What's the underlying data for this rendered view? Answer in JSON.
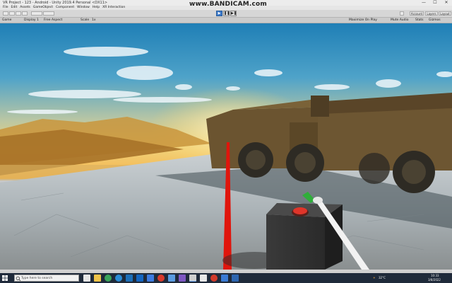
{
  "window": {
    "title": "VR Project - 123 - Android - Unity 2019.4 Personal <DX11>",
    "watermark": "www.BANDICAM.com",
    "controls": [
      "—",
      "☐",
      "✕"
    ]
  },
  "menu": [
    "File",
    "Edit",
    "Assets",
    "GameObject",
    "Component",
    "Window",
    "Help",
    "XR Interaction"
  ],
  "toolbar": {
    "account_label": "Account",
    "layers_label": "Layers",
    "layout_label": "Layout",
    "play_icons": [
      "▶",
      "❚❚",
      "▶❚"
    ]
  },
  "game_header": {
    "tab_label": "Game",
    "display_label": "Display 1",
    "aspect_label": "Free Aspect",
    "scale_label": "Scale",
    "scale_value": "1x",
    "maximize_label": "Maximize On Play",
    "mute_label": "Mute Audio",
    "stats_label": "Stats",
    "gizmos_label": "Gizmos"
  },
  "status": {
    "text": ""
  },
  "taskbar": {
    "search_placeholder": "Type here to search",
    "weather": "32°C",
    "clock_time": "10:33",
    "clock_date": "3/8/2022"
  }
}
